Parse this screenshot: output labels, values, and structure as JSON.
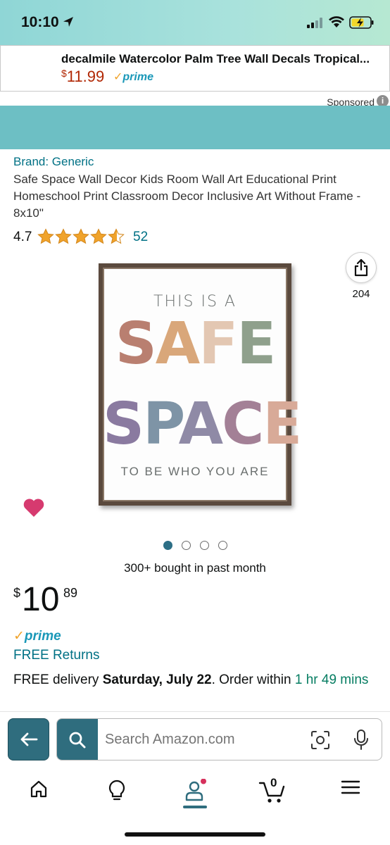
{
  "status_bar": {
    "time": "10:10"
  },
  "sponsored_ad": {
    "title": "decalmile Watercolor Palm Tree Wall Decals Tropical...",
    "price_currency": "$",
    "price": "11.99",
    "prime_label": "prime",
    "sponsored_label": "Sponsored",
    "info_label": "i"
  },
  "product": {
    "brand": "Brand: Generic",
    "title": "Safe Space Wall Decor Kids Room Wall Art Educational Print Homeschool Print Classroom Decor Inclusive Art Without Frame - 8x10\"",
    "rating": "4.7",
    "rating_fraction": 0.94,
    "review_count": "52",
    "share_count": "204",
    "image": {
      "line1": "THIS IS A",
      "line2": "SAFE",
      "line3": "SPACE",
      "line4": "TO BE WHO YOU ARE"
    },
    "bought_text": "300+ bought in past month",
    "price_currency": "$",
    "price_whole": "10",
    "price_fraction": "89",
    "prime_label": "prime",
    "returns": "FREE Returns",
    "delivery_prefix": "FREE delivery ",
    "delivery_date": "Saturday, July 22",
    "delivery_mid": ". Order within ",
    "delivery_countdown": "1 hr 49 mins"
  },
  "carousel": {
    "count": 4,
    "active": 0
  },
  "search": {
    "placeholder": "Search Amazon.com"
  },
  "nav": {
    "cart_count": "0"
  },
  "colors": {
    "link": "#007185",
    "price_red": "#b12704",
    "prime_blue": "#1a98b8",
    "teal": "#2f6d7e",
    "star": "#f0a32b",
    "heart": "#d63a6f"
  }
}
